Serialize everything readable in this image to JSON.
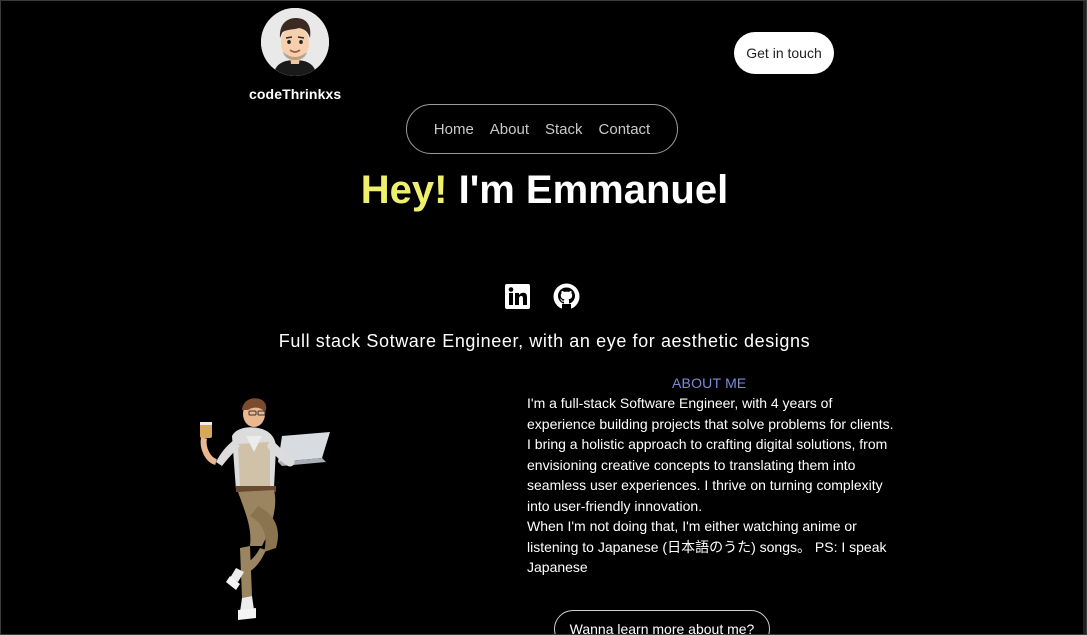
{
  "brand": {
    "name": "codeThrinkxs",
    "avatar_icon": "cartoon-avatar"
  },
  "header": {
    "cta_label": "Get in touch"
  },
  "nav": {
    "items": [
      {
        "label": "Home"
      },
      {
        "label": "About"
      },
      {
        "label": "Stack"
      },
      {
        "label": "Contact"
      }
    ]
  },
  "hero": {
    "greeting": "Hey!",
    "name": "I'm Emmanuel",
    "greeting_color": "#eef06d"
  },
  "socials": [
    {
      "icon": "linkedin-icon"
    },
    {
      "icon": "github-icon"
    }
  ],
  "tagline": "Full stack Sotware Engineer, with an eye for aesthetic designs",
  "about": {
    "label": "ABOUT ME",
    "label_color": "#7b8dd6",
    "paragraphs": [
      "I'm a full-stack Software Engineer, with 4 years of experience building projects that solve problems for clients.",
      "I bring a holistic approach to crafting digital solutions, from envisioning creative concepts to translating them into seamless user experiences. I thrive on turning complexity into user-friendly innovation.",
      "When I'm not doing that, I'm either watching anime or listening to Japanese (日本語のうた) songs。 PS: I speak Japanese"
    ],
    "button_label": "Wanna learn more about me?"
  }
}
